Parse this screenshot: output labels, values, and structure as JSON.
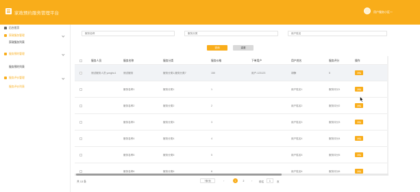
{
  "app": {
    "title": "家政预约服务管理平台",
    "user_name": "用户服务小区一"
  },
  "sidebar": {
    "items": [
      {
        "label": "后台首页"
      },
      {
        "label": "家政服务管理"
      },
      {
        "label": "家政服务列表"
      },
      {
        "label": "服务预约管理"
      },
      {
        "label": "服务预约列表"
      },
      {
        "label": "服务评价管理"
      },
      {
        "label": "服务评价列表"
      }
    ]
  },
  "filters": {
    "service_name": "服务名称",
    "service_category": "服务分类",
    "user_name": "用户姓名",
    "search_label": "查询",
    "reset_label": "重置"
  },
  "table": {
    "columns": [
      "服务人员",
      "服务名称",
      "服务分类",
      "服务价格",
      "下单用户",
      "用户姓名",
      "服务评分",
      "操作"
    ],
    "action_label": "详情",
    "rows": [
      {
        "staff": "测试服务人员 yonghu1",
        "name": "测试服务",
        "category": "服务分类1,服务分类7",
        "price": "150",
        "account": "用户-123123",
        "user": "胡静",
        "score": "5"
      },
      {
        "staff": "",
        "name": "服务名称1",
        "category": "服务分类1",
        "price": "1",
        "account": "",
        "user": "用户姓名1",
        "score": "服务评分1"
      },
      {
        "staff": "",
        "name": "服务名称2",
        "category": "服务分类2",
        "price": "2",
        "account": "",
        "user": "用户姓名2",
        "score": "服务评分2"
      },
      {
        "staff": "",
        "name": "服务名称3",
        "category": "服务分类3",
        "price": "3",
        "account": "",
        "user": "用户姓名3",
        "score": "服务评分3"
      },
      {
        "staff": "",
        "name": "服务名称4",
        "category": "服务分类4",
        "price": "4",
        "account": "",
        "user": "用户姓名4",
        "score": "服务评分4"
      },
      {
        "staff": "",
        "name": "服务名称5",
        "category": "服务分类5",
        "price": "5",
        "account": "",
        "user": "用户姓名5",
        "score": "服务评分5"
      },
      {
        "staff": "",
        "name": "服务名称6",
        "category": "服务分类6",
        "price": "6",
        "account": "",
        "user": "用户姓名6",
        "score": "服务评分6"
      }
    ]
  },
  "pagination": {
    "total": "共 13 条",
    "page_size": "7条/页",
    "prev": "‹",
    "pages": [
      "1",
      "2"
    ],
    "next": "›",
    "goto": "前往",
    "current": "1",
    "page_suffix": "页"
  },
  "colors": {
    "accent": "#f9ad1a"
  },
  "icons": [
    "menu-icon",
    "home-icon",
    "box-icon",
    "chevron-down-icon",
    "checkbox-icon",
    "cursor-icon"
  ]
}
